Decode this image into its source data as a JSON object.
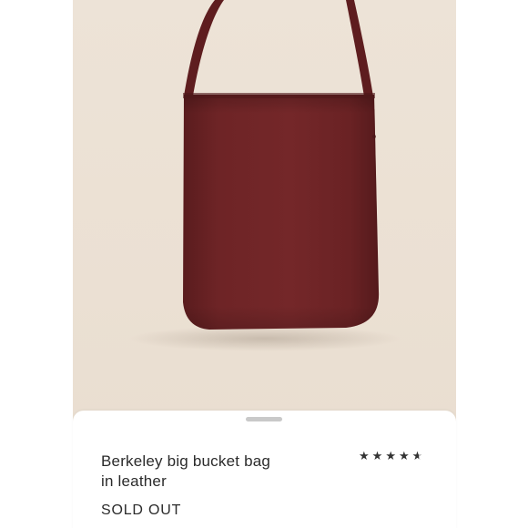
{
  "product": {
    "title_line1": "Berkeley big bucket bag",
    "title_line2": "in leather",
    "status": "SOLD OUT",
    "rating": 4.5,
    "rating_max": 5,
    "bag_color": "#6e2426",
    "background_color": "#ebe1d5"
  },
  "icons": {
    "favorite": "heart-outline-icon"
  }
}
